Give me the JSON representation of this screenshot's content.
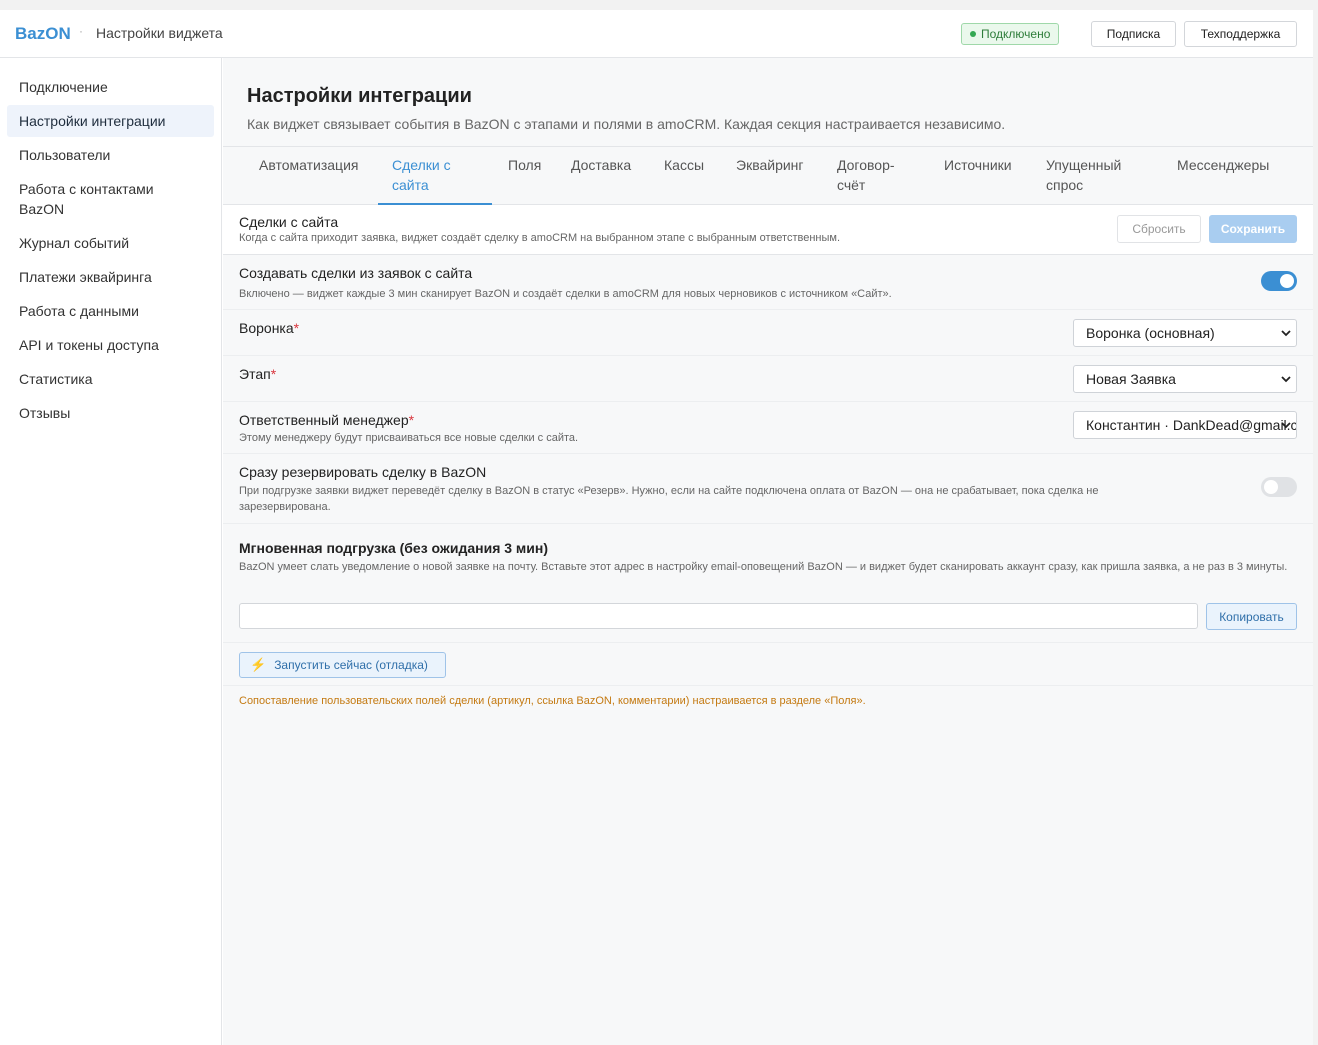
{
  "topbar": {
    "brand": "BazON",
    "separator": "·",
    "caption": "Настройки виджета",
    "status": "Подключено",
    "subscription_label": "Подписка",
    "support_label": "Техподдержка"
  },
  "sidebar": {
    "items": [
      {
        "label": "Подключение"
      },
      {
        "label": "Настройки интеграции"
      },
      {
        "label": "Пользователи"
      },
      {
        "label": "Работа с контактами BazON"
      },
      {
        "label": "Журнал событий"
      },
      {
        "label": "Платежи эквайринга"
      },
      {
        "label": "Работа с данными"
      },
      {
        "label": "API и токены доступа"
      },
      {
        "label": "Статистика"
      },
      {
        "label": "Отзывы"
      }
    ]
  },
  "header": {
    "title": "Настройки интеграции",
    "description": "Как виджет связывает события в BazON с этапами и полями в amoCRM. Каждая секция настраивается независимо."
  },
  "tabs": [
    {
      "label": "Автоматизация"
    },
    {
      "label": "Сделки с сайта"
    },
    {
      "label": "Поля"
    },
    {
      "label": "Доставка"
    },
    {
      "label": "Кассы"
    },
    {
      "label": "Эквайринг"
    },
    {
      "label": "Договор-счёт"
    },
    {
      "label": "Источники"
    },
    {
      "label": "Упущенный спрос"
    },
    {
      "label": "Мессенджеры"
    }
  ],
  "section": {
    "title": "Сделки с сайта",
    "description": "Когда с сайта приходит заявка, виджет создаёт сделку в amoCRM на выбранном этапе с выбранным ответственным.",
    "reset_label": "Сбросить",
    "save_label": "Сохранить"
  },
  "settings": {
    "create_deals": {
      "label": "Создавать сделки из заявок с сайта",
      "hint": "Включено — виджет каждые 3 мин сканирует BazON и создаёт сделки в amoCRM для новых черновиков с источником «Сайт».",
      "enabled": true
    },
    "pipeline": {
      "label": "Воронка",
      "required_mark": "*",
      "value": "Воронка (основная)"
    },
    "stage": {
      "label": "Этап",
      "required_mark": "*",
      "value": "Новая Заявка"
    },
    "manager": {
      "label": "Ответственный менеджер",
      "required_mark": "*",
      "value": "Константин · DankDead@gmail.com",
      "hint": "Этому менеджеру будут присваиваться все новые сделки с сайта."
    },
    "reserve": {
      "label": "Сразу резервировать сделку в BazON",
      "hint": "При подгрузке заявки виджет переведёт сделку в BazON в статус «Резерв». Нужно, если на сайте подключена оплата от BazON — она не срабатывает, пока сделка не зарезервирована.",
      "enabled": false
    },
    "instant": {
      "label": "Мгновенная подгрузка (без ожидания 3 мин)",
      "hint": "BazON умеет слать уведомление о новой заявке на почту. Вставьте этот адрес в настройку email-оповещений BazON — и виджет будет сканировать аккаунт сразу, как пришла заявка, а не раз в 3 минуты.",
      "copy_label": "Копировать"
    }
  },
  "run_now_label": "Запустить сейчас (отладка)",
  "footer_note": "Сопоставление пользовательских полей сделки (артикул, ссылка BazON, комментарии) настраивается в разделе «Поля».",
  "colors": {
    "accent": "#3b8fd3",
    "status_green": "#34a853",
    "note_orange": "#c47a12",
    "required_red": "#d9363e"
  }
}
